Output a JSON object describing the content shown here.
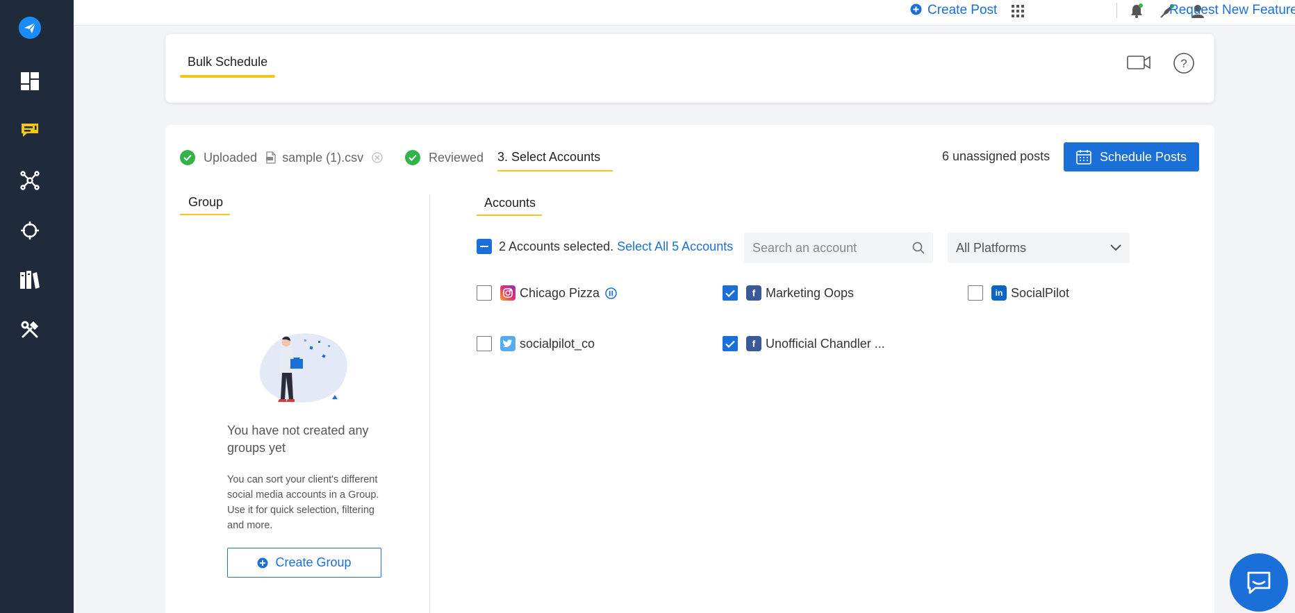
{
  "topbar": {
    "create_post_label": "Create Post",
    "request_feature_label": "Request New Feature"
  },
  "header": {
    "tab_label": "Bulk Schedule"
  },
  "steps": {
    "uploaded_label": "Uploaded",
    "file_name": "sample (1).csv",
    "reviewed_label": "Reviewed",
    "current_step_label": "3. Select Accounts"
  },
  "actions": {
    "unassigned_text": "6 unassigned posts",
    "schedule_button_label": "Schedule Posts"
  },
  "group_panel": {
    "title": "Group",
    "empty_title": "You have not created any groups yet",
    "empty_description": "You can sort your client's different social media accounts in a Group. Use it for quick selection, filtering and more.",
    "create_group_label": "Create Group"
  },
  "accounts_panel": {
    "title": "Accounts",
    "selected_text": "2 Accounts selected.",
    "select_all_label": "Select All 5 Accounts",
    "search_placeholder": "Search an account",
    "platform_filter_value": "All Platforms",
    "accounts": [
      {
        "name": "Chicago Pizza",
        "network": "instagram",
        "checked": false
      },
      {
        "name": "Marketing Oops",
        "network": "facebook",
        "checked": true
      },
      {
        "name": "SocialPilot",
        "network": "linkedin",
        "checked": false
      },
      {
        "name": "socialpilot_co",
        "network": "twitter",
        "checked": false
      },
      {
        "name": "Unofficial Chandler ...",
        "network": "facebook",
        "checked": true
      }
    ]
  },
  "colors": {
    "accent": "#1a6fd9",
    "sidebar": "#1f2a3a",
    "underline": "#f5c518",
    "success": "#34b34a"
  },
  "icons": {
    "logo": "paper-plane-icon",
    "sidebar": [
      "dashboard-icon",
      "messages-icon",
      "network-icon",
      "target-icon",
      "library-icon",
      "tools-icon"
    ],
    "topbar": [
      "apps-grid-icon",
      "bell-icon",
      "rocket-icon",
      "user-icon"
    ],
    "header": [
      "video-icon",
      "help-icon"
    ]
  }
}
